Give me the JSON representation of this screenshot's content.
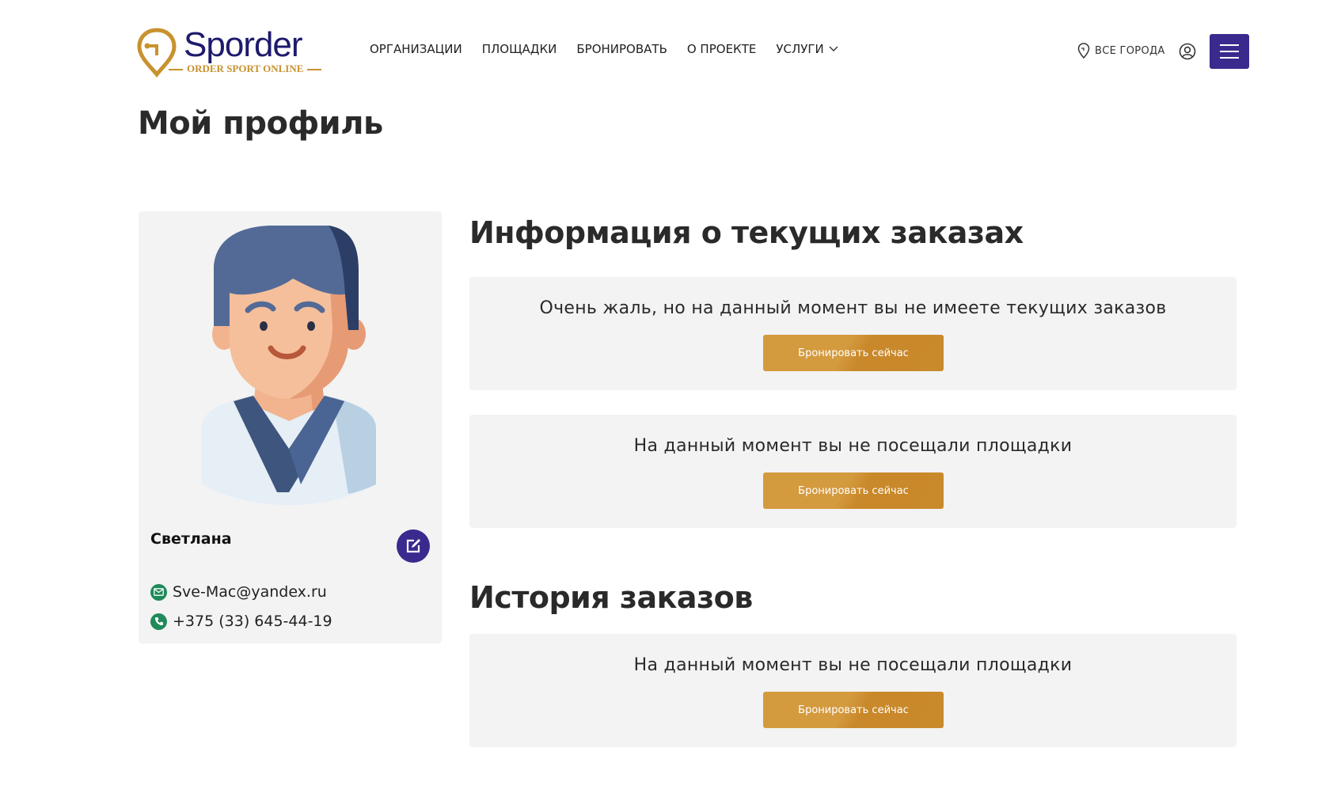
{
  "brand": {
    "name": "Sporder",
    "tagline": "ORDER SPORT ONLINE",
    "primary_color": "#3a2a8e",
    "accent_color": "#d49a3e"
  },
  "nav": {
    "items": [
      {
        "label": "ОРГАНИЗАЦИИ"
      },
      {
        "label": "ПЛОЩАДКИ"
      },
      {
        "label": "БРОНИРОВАТЬ"
      },
      {
        "label": "О ПРОЕКТЕ"
      },
      {
        "label": "УСЛУГИ",
        "has_dropdown": true
      }
    ],
    "city_label": "ВСЕ ГОРОДА",
    "icons": [
      "location-pin-icon",
      "user-icon",
      "hamburger-menu-icon",
      "chevron-down-icon"
    ]
  },
  "page": {
    "title": "Мой профиль"
  },
  "profile": {
    "name": "Светлана",
    "email": "Sve-Mac@yandex.ru",
    "phone": "+375 (33) 645-44-19",
    "icons": [
      "avatar",
      "edit-icon",
      "email-icon",
      "phone-icon"
    ]
  },
  "current_orders": {
    "title": "Информация о текущих заказах",
    "panels": [
      {
        "message": "Очень жаль, но на данный момент вы не имеете текущих заказов",
        "button": "Бронировать сейчас"
      },
      {
        "message": "На данный момент вы не посещали площадки",
        "button": "Бронировать сейчас"
      }
    ]
  },
  "history": {
    "title": "История заказов",
    "panels": [
      {
        "message": "На данный момент вы не посещали площадки",
        "button": "Бронировать сейчас"
      }
    ]
  }
}
